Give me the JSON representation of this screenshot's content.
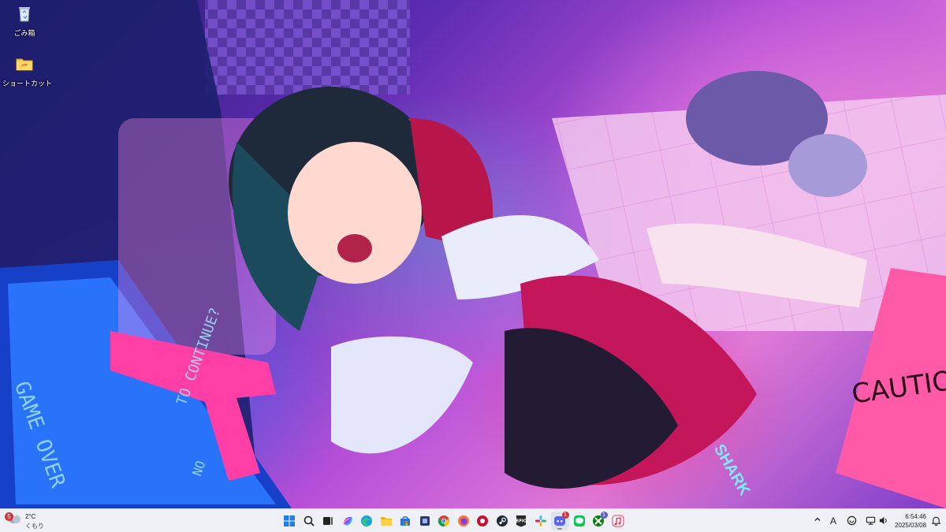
{
  "desktop": {
    "icons": [
      {
        "label": "ごみ箱",
        "icon": "recycle-bin-icon"
      },
      {
        "label": "ショートカット",
        "icon": "folder-shortcut-icon"
      }
    ]
  },
  "wallpaper": {
    "sign_text": "CAUTION",
    "screen_text_1": "GAME OVER",
    "screen_text_2": "TO CONTINUE?",
    "screen_text_3": "NO",
    "scarf_text": "SHARK"
  },
  "taskbar": {
    "weather": {
      "badge": "5",
      "temp": "2°C",
      "condition": "くもり"
    },
    "apps": [
      {
        "name": "start",
        "icon": "windows-start-icon"
      },
      {
        "name": "search",
        "icon": "search-icon"
      },
      {
        "name": "task-view",
        "icon": "task-view-icon"
      },
      {
        "name": "copilot",
        "icon": "copilot-icon"
      },
      {
        "name": "edge",
        "icon": "edge-icon"
      },
      {
        "name": "file-explorer",
        "icon": "file-explorer-icon"
      },
      {
        "name": "store",
        "icon": "store-icon"
      },
      {
        "name": "taskbar-app",
        "icon": "app-icon"
      },
      {
        "name": "chrome",
        "icon": "chrome-icon"
      },
      {
        "name": "firefox",
        "icon": "firefox-icon"
      },
      {
        "name": "red-app",
        "icon": "red-app-icon"
      },
      {
        "name": "steam",
        "icon": "steam-icon"
      },
      {
        "name": "epic",
        "icon": "epic-games-icon",
        "label": "EPIC"
      },
      {
        "name": "slack",
        "icon": "slack-icon"
      },
      {
        "name": "discord",
        "icon": "discord-icon",
        "badge": "1",
        "active": true
      },
      {
        "name": "line",
        "icon": "line-icon"
      },
      {
        "name": "xbox",
        "icon": "xbox-icon",
        "badge": "1"
      },
      {
        "name": "apple-music",
        "icon": "music-icon"
      }
    ],
    "tray": {
      "ime": "A",
      "time": "6:54:46",
      "date": "2025/03/08"
    }
  },
  "colors": {
    "taskbar_bg": "#eef0f6",
    "accent": "#5b5fc7",
    "badge_red": "#d13438"
  }
}
